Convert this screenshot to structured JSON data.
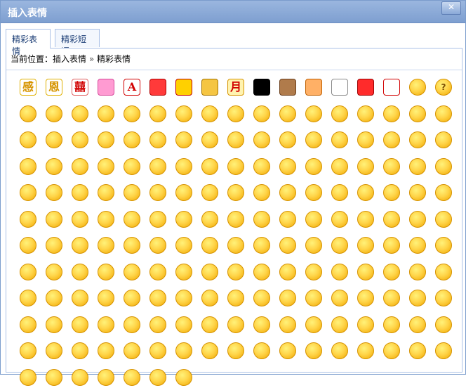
{
  "window": {
    "title": "插入表情",
    "close_label": "✕"
  },
  "tabs": [
    {
      "label": "精彩表情",
      "active": true
    },
    {
      "label": "精彩短语",
      "active": false
    }
  ],
  "breadcrumb": {
    "prefix": "当前位置：",
    "section": "插入表情",
    "sep": "»",
    "current": "精彩表情"
  },
  "grid": {
    "rows": [
      [
        {
          "name": "chinese-char-gan-icon",
          "text": "感",
          "style": "char"
        },
        {
          "name": "chinese-char-en-icon",
          "text": "恩",
          "style": "char"
        },
        {
          "name": "double-happiness-icon",
          "text": "囍",
          "style": "red-char"
        },
        {
          "name": "beanie-hat-icon",
          "text": "",
          "style": "pink"
        },
        {
          "name": "letter-a-icon",
          "text": "A",
          "style": "red-letter"
        },
        {
          "name": "red-heart-boxes-icon",
          "text": "",
          "style": "red"
        },
        {
          "name": "scroll-icon",
          "text": "",
          "style": "scroll"
        },
        {
          "name": "gold-box-icon",
          "text": "",
          "style": "gold"
        },
        {
          "name": "yue-character-icon",
          "text": "月",
          "style": "yue"
        },
        {
          "name": "black-square-icon",
          "text": "",
          "style": "black"
        },
        {
          "name": "mooncake-icon",
          "text": "",
          "style": "brown"
        },
        {
          "name": "tree-icon",
          "text": "",
          "style": "tree"
        },
        {
          "name": "calendar-icon",
          "text": "",
          "style": "calendar"
        },
        {
          "name": "china-flag-icon",
          "text": "",
          "style": "flag"
        },
        {
          "name": "red-sign-icon",
          "text": "",
          "style": "redsign"
        },
        {
          "name": "smiley-face-icon",
          "text": "",
          "style": "face"
        },
        {
          "name": "question-face-icon",
          "text": "?",
          "style": "face"
        }
      ]
    ],
    "visible_row_count": 12
  }
}
